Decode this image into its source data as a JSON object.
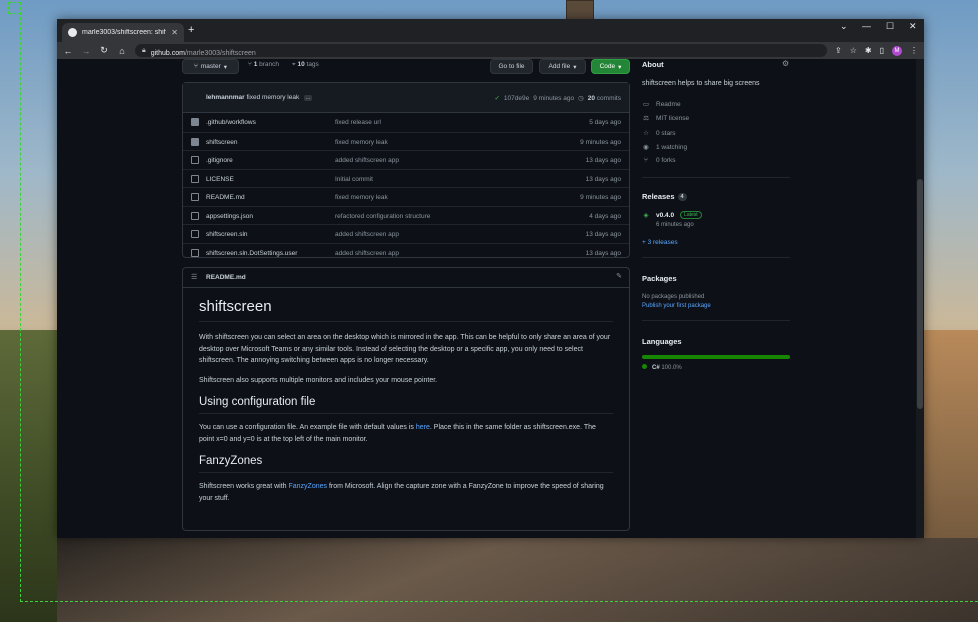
{
  "browser": {
    "tab_title": "marle3003/shiftscreen: shiftscree",
    "new_tab": "+",
    "url_host": "github.com",
    "url_path": "/marle3003/shiftscreen",
    "profile_initial": "M",
    "window_controls": {
      "chevron": "⌄",
      "minimize": "—",
      "maximize": "☐",
      "close": "✕"
    }
  },
  "repo_bar": {
    "branch": "master",
    "branches_count": "1",
    "branches_label": "branch",
    "tags_count": "10",
    "tags_label": "tags",
    "go_to_file": "Go to file",
    "add_file": "Add file",
    "code": "Code"
  },
  "commit": {
    "author": "lehmannmar",
    "message": "fixed memory leak",
    "ellipsis": "...",
    "hash": "107de9e",
    "time": "9 minutes ago",
    "commits_count": "20",
    "commits_label": "commits"
  },
  "files": [
    {
      "name": ".github/workflows",
      "message": "fixed release url",
      "age": "5 days ago",
      "type": "dir"
    },
    {
      "name": "shiftscreen",
      "message": "fixed memory leak",
      "age": "9 minutes ago",
      "type": "dir"
    },
    {
      "name": ".gitignore",
      "message": "added shiftscreen app",
      "age": "13 days ago",
      "type": "file"
    },
    {
      "name": "LICENSE",
      "message": "Initial commit",
      "age": "13 days ago",
      "type": "file"
    },
    {
      "name": "README.md",
      "message": "fixed memory leak",
      "age": "9 minutes ago",
      "type": "file"
    },
    {
      "name": "appsettings.json",
      "message": "refactored configuration structure",
      "age": "4 days ago",
      "type": "file"
    },
    {
      "name": "shiftscreen.sln",
      "message": "added shiftscreen app",
      "age": "13 days ago",
      "type": "file"
    },
    {
      "name": "shiftscreen.sln.DotSettings.user",
      "message": "added shiftscreen app",
      "age": "13 days ago",
      "type": "file"
    }
  ],
  "readme": {
    "file_label": "README.md",
    "h1": "shiftscreen",
    "p1": "With shiftscreen you can select an area on the desktop which is mirrored in the app. This can be helpful to only share an area of your desktop over Microsoft Teams or any similar tools. Instead of selecting the desktop or a specific app, you only need to select shiftscreen. The annoying switching between apps is no longer necessary.",
    "p2": "Shiftscreen also supports multiple monitors and includes your mouse pointer.",
    "h2_config": "Using configuration file",
    "p3_before": "You can use a configuration file. An example file with default values is ",
    "p3_link": "here",
    "p3_after": ". Place this in the same folder as shiftscreen.exe. The point x=0 and y=0 is at the top left of the main monitor.",
    "h2_fancy": "FanzyZones",
    "p4_before": "Shiftscreen works great with ",
    "p4_link": "FanzyZones",
    "p4_after": " from Microsoft. Align the capture zone with a FanzyZone to improve the speed of sharing your stuff."
  },
  "about": {
    "title": "About",
    "description": "shiftscreen helps to share big screens",
    "items": [
      {
        "icon": "book-icon",
        "glyph": "▭",
        "label": "Readme"
      },
      {
        "icon": "scale-icon",
        "glyph": "⚖",
        "label": "MIT license"
      },
      {
        "icon": "star-icon",
        "glyph": "☆",
        "label": "0 stars"
      },
      {
        "icon": "eye-icon",
        "glyph": "◉",
        "label": "1 watching"
      },
      {
        "icon": "fork-icon",
        "glyph": "⑂",
        "label": "0 forks"
      }
    ]
  },
  "releases": {
    "title": "Releases",
    "count": "4",
    "version": "v0.4.0",
    "latest": "Latest",
    "when": "6 minutes ago",
    "more": "+ 3 releases"
  },
  "packages": {
    "title": "Packages",
    "none": "No packages published",
    "publish_link": "Publish your first package"
  },
  "languages": {
    "title": "Languages",
    "name": "C#",
    "percent": "100.0%",
    "share": 1.0,
    "color": "#178600"
  }
}
